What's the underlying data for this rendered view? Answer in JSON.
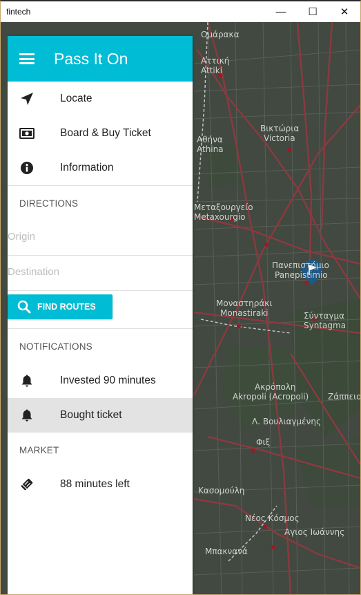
{
  "window": {
    "title": "fintech",
    "minimize": "—",
    "maximize": "☐",
    "close": "✕"
  },
  "drawer": {
    "app_title": "Pass It On",
    "accent_color": "#00bcd4",
    "nav": [
      {
        "label": "Locate",
        "icon": "navigation-arrow-icon"
      },
      {
        "label": "Board & Buy Ticket",
        "icon": "ticket-money-icon"
      },
      {
        "label": "Information",
        "icon": "info-icon"
      }
    ],
    "directions": {
      "header": "DIRECTIONS",
      "origin_placeholder": "Origin",
      "destination_placeholder": "Destination",
      "find_routes_label": "FIND ROUTES"
    },
    "notifications": {
      "header": "NOTIFICATIONS",
      "items": [
        {
          "label": "Invested 90 minutes",
          "icon": "bell-icon"
        },
        {
          "label": "Bought ticket",
          "icon": "bell-icon",
          "selected": true
        }
      ]
    },
    "market": {
      "header": "MARKET",
      "items": [
        {
          "label": "88 minutes left",
          "icon": "tag-icon"
        }
      ]
    }
  },
  "map": {
    "labels": [
      {
        "text": "Ομάρακα"
      },
      {
        "text": "Αττική"
      },
      {
        "text": "Attiki"
      },
      {
        "text": "Βικτώρια"
      },
      {
        "text": "Victoria"
      },
      {
        "text": "Αθήνα"
      },
      {
        "text": "Athina"
      },
      {
        "text": "Μεταξουργείο"
      },
      {
        "text": "Metaxourgio"
      },
      {
        "text": "Πανεπιστήμιο"
      },
      {
        "text": "Panepistimio"
      },
      {
        "text": "Μοναστηράκι"
      },
      {
        "text": "Monastiraki"
      },
      {
        "text": "Σύνταγμα"
      },
      {
        "text": "Syntagma"
      },
      {
        "text": "Ακρόπολη"
      },
      {
        "text": "Akropoli (Acropoli)"
      },
      {
        "text": "Ζάππειο"
      },
      {
        "text": "Λ. Βουλιαγμένης"
      },
      {
        "text": "Φιξ"
      },
      {
        "text": "Κασομούλη"
      },
      {
        "text": "Νέος Κόσμος"
      },
      {
        "text": "Αγιος Ιωάννης"
      },
      {
        "text": "Μπακνανά"
      }
    ]
  }
}
